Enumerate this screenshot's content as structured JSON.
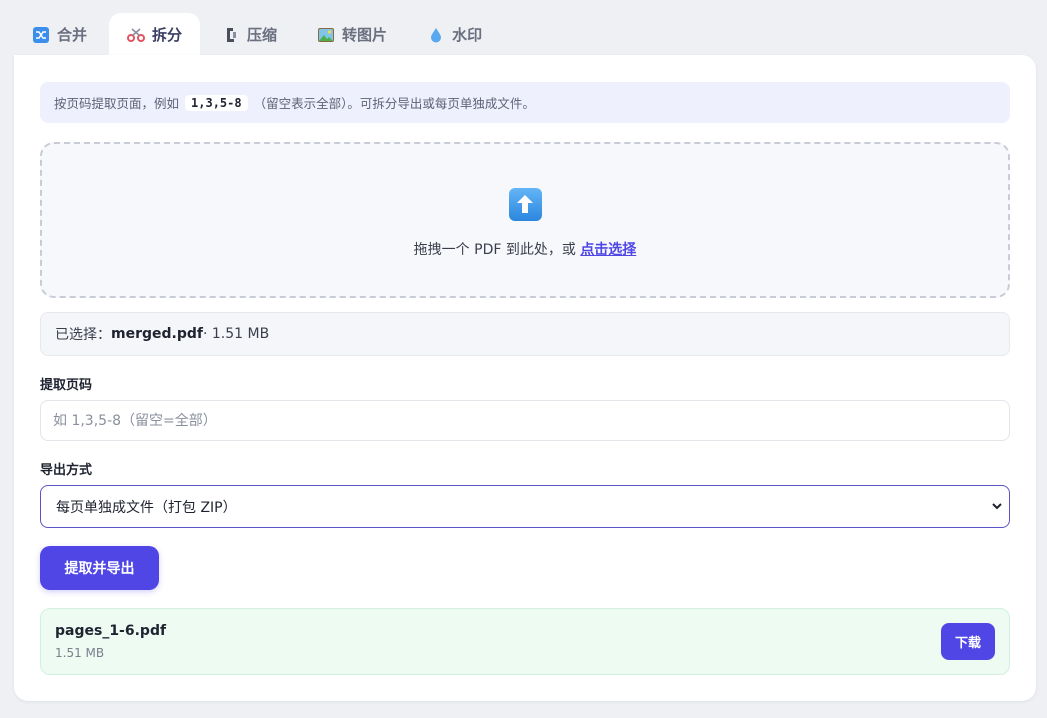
{
  "tabs": [
    {
      "label": "合并",
      "icon": "shuffle-icon"
    },
    {
      "label": "拆分",
      "icon": "scissors-icon",
      "active": true
    },
    {
      "label": "压缩",
      "icon": "clamp-icon"
    },
    {
      "label": "转图片",
      "icon": "picture-icon"
    },
    {
      "label": "水印",
      "icon": "droplet-icon"
    }
  ],
  "hint": {
    "prefix": "按页码提取页面，例如",
    "example": "1,3,5-8",
    "suffix": "（留空表示全部）。可拆分导出或每页单独成文件。"
  },
  "dropzone": {
    "text": "拖拽一个 PDF 到此处，或",
    "link": "点击选择"
  },
  "selected": {
    "prefix": "已选择：",
    "filename": "merged.pdf",
    "size": " · 1.51 MB"
  },
  "pages_field": {
    "label": "提取页码",
    "placeholder": "如 1,3,5-8（留空=全部）",
    "value": ""
  },
  "export_field": {
    "label": "导出方式",
    "selected": "每页单独成文件（打包 ZIP）"
  },
  "submit_label": "提取并导出",
  "result": {
    "filename": "pages_1-6.pdf",
    "size": "1.51 MB",
    "download_label": "下载"
  },
  "colors": {
    "accent": "#4f46e5",
    "result_bg": "#edfbf3",
    "hint_bg": "#eef1fd"
  }
}
